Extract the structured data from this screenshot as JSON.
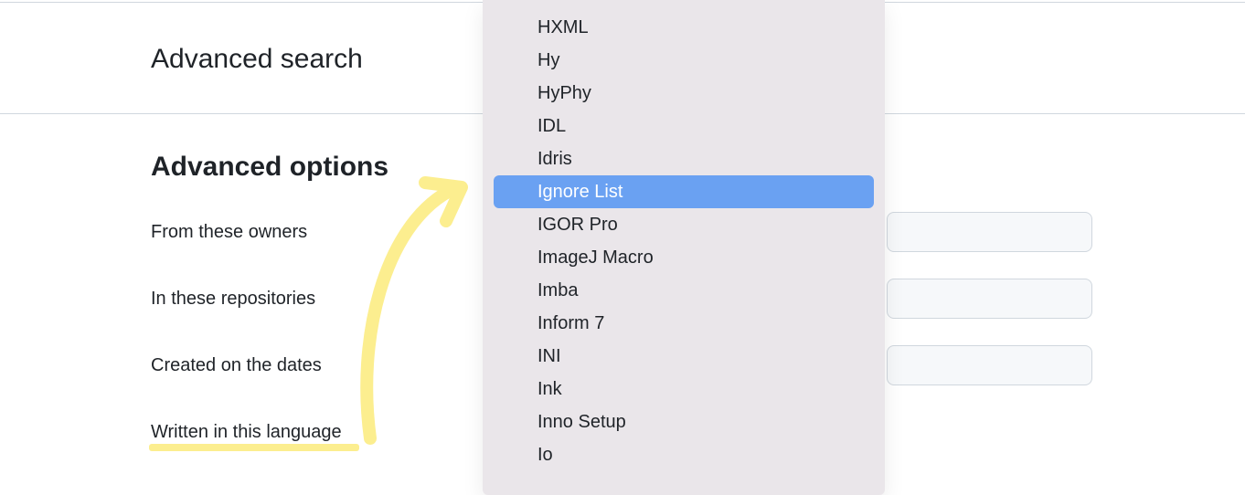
{
  "page": {
    "title": "Advanced search"
  },
  "section": {
    "title": "Advanced options"
  },
  "labels": {
    "owners": "From these owners",
    "repos": "In these repositories",
    "dates": "Created on the dates",
    "language": "Written in this language"
  },
  "dropdown": {
    "items": [
      {
        "label": "HXML",
        "selected": false
      },
      {
        "label": "Hy",
        "selected": false
      },
      {
        "label": "HyPhy",
        "selected": false
      },
      {
        "label": "IDL",
        "selected": false
      },
      {
        "label": "Idris",
        "selected": false
      },
      {
        "label": "Ignore List",
        "selected": true
      },
      {
        "label": "IGOR Pro",
        "selected": false
      },
      {
        "label": "ImageJ Macro",
        "selected": false
      },
      {
        "label": "Imba",
        "selected": false
      },
      {
        "label": "Inform 7",
        "selected": false
      },
      {
        "label": "INI",
        "selected": false
      },
      {
        "label": "Ink",
        "selected": false
      },
      {
        "label": "Inno Setup",
        "selected": false
      },
      {
        "label": "Io",
        "selected": false
      }
    ]
  },
  "annotations": {
    "highlight_label": "language",
    "arrow_color": "#fcee8f"
  }
}
